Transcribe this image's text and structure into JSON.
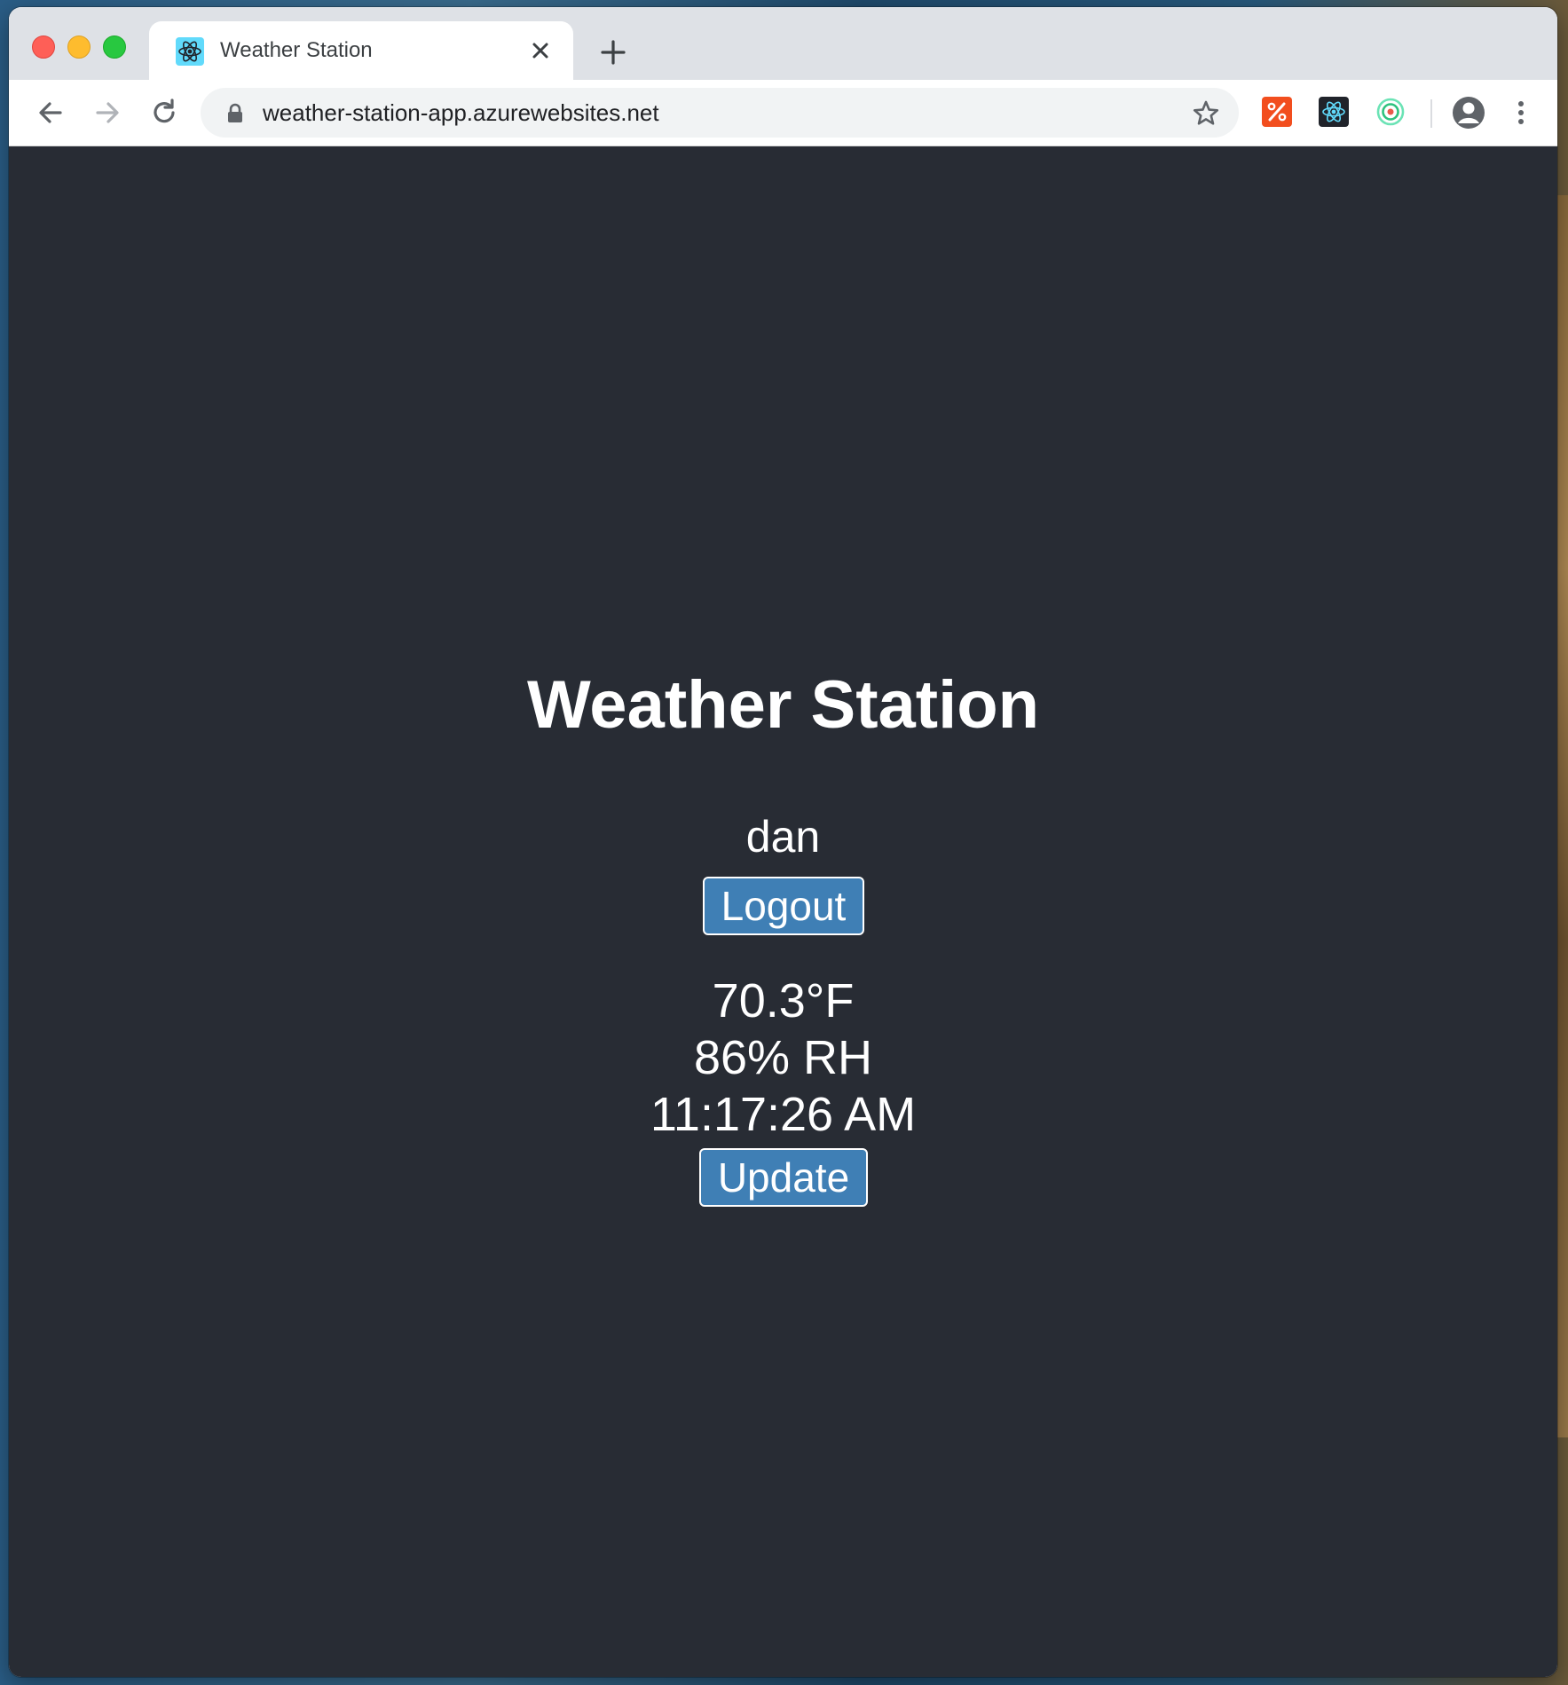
{
  "browser": {
    "tab": {
      "title": "Weather Station",
      "favicon": "react-icon"
    },
    "address_bar": {
      "url": "weather-station-app.azurewebsites.net"
    }
  },
  "page": {
    "title": "Weather Station",
    "user": "dan",
    "logout_label": "Logout",
    "temperature": "70.3°F",
    "humidity": "86% RH",
    "time": "11:17:26 AM",
    "update_label": "Update"
  },
  "colors": {
    "page_background": "#282c34",
    "button_background": "#3f7fb5",
    "text": "#ffffff"
  }
}
